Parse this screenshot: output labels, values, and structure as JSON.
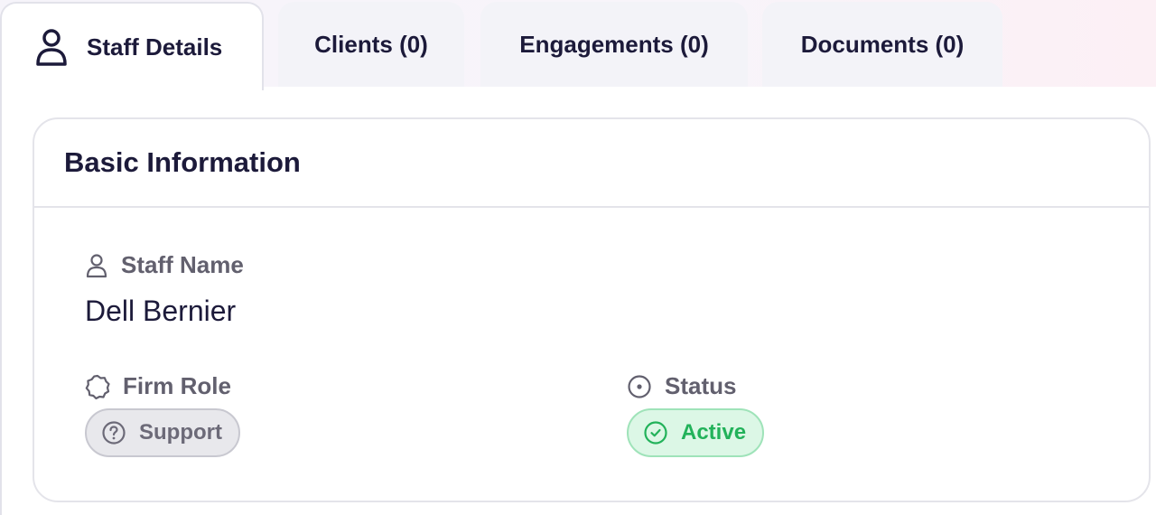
{
  "tabs": [
    {
      "label": "Staff Details",
      "icon": "user-icon",
      "active": true
    },
    {
      "label": "Clients (0)",
      "active": false
    },
    {
      "label": "Engagements (0)",
      "active": false
    },
    {
      "label": "Documents (0)",
      "active": false
    }
  ],
  "card": {
    "title": "Basic Information",
    "staff_name": {
      "label": "Staff Name",
      "icon": "user-icon",
      "value": "Dell Bernier"
    },
    "firm_role": {
      "label": "Firm Role",
      "icon": "badge-outline-icon",
      "value": "Support",
      "value_icon": "question-circle-icon"
    },
    "status": {
      "label": "Status",
      "icon": "dot-circle-icon",
      "value": "Active",
      "value_icon": "check-circle-icon"
    }
  },
  "colors": {
    "text_primary": "#1c1a3a",
    "label_gray": "#62606e",
    "active_green": "#22b25a",
    "active_bg": "#dcf7e6",
    "role_bg": "#e8e8ec"
  }
}
